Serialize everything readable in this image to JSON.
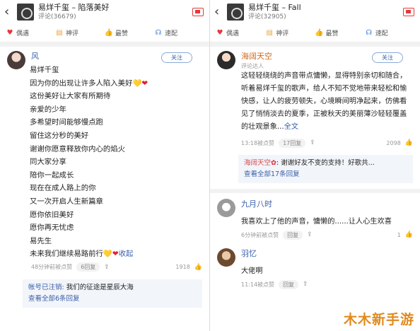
{
  "left": {
    "header": {
      "title": "易烊千玺 – 陷落美好",
      "subtitle": "评论(36679)"
    },
    "tabs": [
      "偶遇",
      "神评",
      "最赞",
      "速配"
    ],
    "comment": {
      "user": "风",
      "follow": "关注",
      "lines": [
        "易烊千玺",
        "因为你的出现让许多人陷入美好",
        "这份美好让大家有所期待",
        "亲爱的少年",
        "多希望时间能够慢点跑",
        "留住这分秒的美好",
        "谢谢你愿意释放你内心的焰火",
        "同大家分享",
        "陪你一起成长",
        "现在在成人路上的你",
        "又一次开启人生新篇章",
        "愿你依旧美好",
        "愿你再无忧虑",
        "易先生",
        "未来我们继续易路前行"
      ],
      "collapse": "收起",
      "time": "48分钟前被点赞",
      "reply_pill": "6回复",
      "likes": "1918",
      "reply_user": "帐号已注销:",
      "reply_text": "我们的征途是星辰大海",
      "view_all": "查看全部6条回复"
    }
  },
  "right": {
    "header": {
      "title": "易烊千玺 – Fall",
      "subtitle": "评论(32905)"
    },
    "tabs": [
      "偶遇",
      "神评",
      "最赞",
      "速配"
    ],
    "c1": {
      "user": "海阔天空",
      "tag": "评论达人",
      "follow": "关注",
      "text": "这轻轻绕绕的声音带点慵懒，显得特别亲切和随合，听着易烊千玺的歌声，给人不知不觉地带来轻松和愉快感，让人的疲劳顿失，心境瞬间明净起来，仿佛看见了悄悄淡去的夏季，正被秋天的美丽薄沙轻轻覆盖的壮观景象...",
      "more": "全文",
      "time": "13:18被点赞",
      "reply_pill": "17回复",
      "likes": "2098",
      "reply_user": "海阔天空",
      "reply_text": "谢谢好友不变的支持！好歌共...",
      "view_all": "查看全部17条回复"
    },
    "c2": {
      "user": "九月八时",
      "text": "我喜欢上了他的声音，慵懒的......让人心生欢喜",
      "time": "6分钟前被点赞",
      "reply_pill": "回复",
      "likes": "1"
    },
    "c3": {
      "user": "羽忆",
      "text": "大佬啊",
      "time": "11:14被点赞",
      "reply_pill": "回复"
    }
  },
  "watermark": "木木新手游"
}
